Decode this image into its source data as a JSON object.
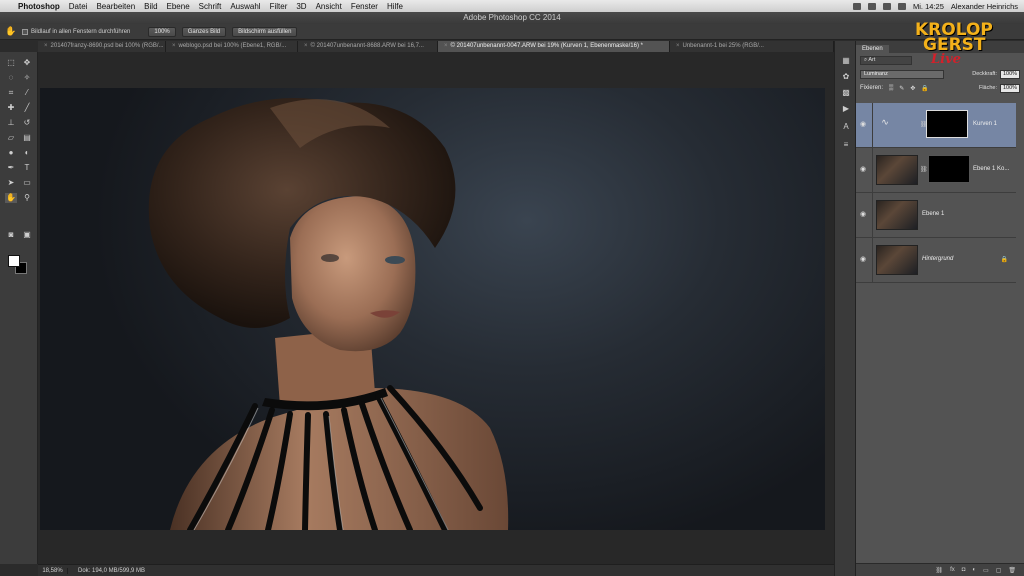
{
  "menubar": {
    "app_name": "Photoshop",
    "items": [
      "Datei",
      "Bearbeiten",
      "Bild",
      "Ebene",
      "Schrift",
      "Auswahl",
      "Filter",
      "3D",
      "Ansicht",
      "Fenster",
      "Hilfe"
    ],
    "clock": "Mi. 14:25",
    "user": "Alexander Heinrichs"
  },
  "window": {
    "title": "Adobe Photoshop CC 2014"
  },
  "options_bar": {
    "checkbox_label": "Bildlauf in allen Fenstern durchführen",
    "btn_100": "100%",
    "btn_fit": "Ganzes Bild",
    "btn_fill": "Bildschirm ausfüllen"
  },
  "tabs": [
    {
      "label": "201407franzy-8690.psd bei 100% (RGB/...",
      "active": false
    },
    {
      "label": "weblogo.psd bei 100% (Ebene1, RGB/...",
      "active": false
    },
    {
      "label": "© 201407unbenannt-8688.ARW bei 16,7...",
      "active": false
    },
    {
      "label": "© 201407unbenannt-0047.ARW bei 19% (Kurven 1, Ebenenmaske/16) *",
      "active": true
    },
    {
      "label": "Unbenannt-1 bei 25% (RGB/...",
      "active": false
    }
  ],
  "status": {
    "zoom": "18,58%",
    "doc": "Dok: 194,0 MB/599,9 MB"
  },
  "layers_panel": {
    "tab": "Ebenen",
    "filter_kind": "Art",
    "blend_mode": "Luminanz",
    "opacity_label": "Deckkraft:",
    "opacity": "100%",
    "lock_label": "Fixieren:",
    "fill_label": "Fläche:",
    "fill": "100%",
    "layers": [
      {
        "name": "Kurven 1",
        "selected": true
      },
      {
        "name": "Ebene 1 Ko...",
        "selected": false
      },
      {
        "name": "Ebene 1",
        "selected": false
      },
      {
        "name": "Hintergrund",
        "selected": false
      }
    ],
    "bottom_icons": [
      "link-icon",
      "fx-icon",
      "mask-icon",
      "adjustment-icon",
      "folder-icon",
      "new-layer-icon",
      "trash-icon"
    ]
  },
  "watermark": {
    "line1": "KROLOP",
    "line2": "GERST",
    "line3": "Live"
  },
  "colors": {
    "accent_selected_layer": "#7686a4",
    "watermark_gold": "#f4b11a",
    "watermark_red": "#d3202a"
  }
}
